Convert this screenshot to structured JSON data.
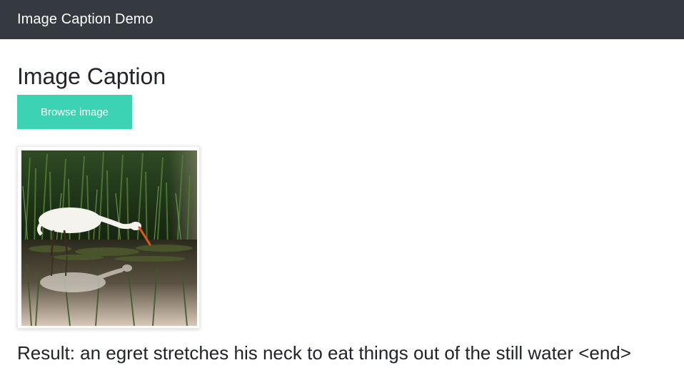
{
  "navbar": {
    "brand": "Image Caption Demo"
  },
  "main": {
    "title": "Image Caption",
    "browse_button_label": "Browse image",
    "result_label": "Result:",
    "result_text": "an egret stretches his neck to eat things out of the still water <end>"
  },
  "colors": {
    "navbar_bg": "#343a40",
    "button_bg": "#3cd2b4",
    "text": "#212529"
  }
}
